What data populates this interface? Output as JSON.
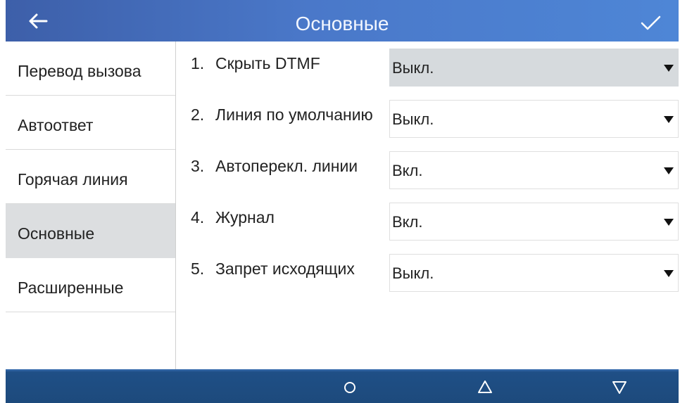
{
  "header": {
    "title": "Основные",
    "back_icon": "back-arrow-icon",
    "confirm_icon": "checkmark-icon"
  },
  "sidebar": {
    "items": [
      {
        "label": "Перевод вызова",
        "active": false
      },
      {
        "label": "Автоответ",
        "active": false
      },
      {
        "label": "Горячая линия",
        "active": false
      },
      {
        "label": "Основные",
        "active": true
      },
      {
        "label": "Расширенные",
        "active": false
      }
    ]
  },
  "settings": [
    {
      "num": "1.",
      "label": "Скрыть DTMF",
      "value": "Выкл.",
      "active": true
    },
    {
      "num": "2.",
      "label": "Линия по умолчанию",
      "value": "Выкл.",
      "active": false
    },
    {
      "num": "3.",
      "label": "Автоперекл. линии",
      "value": "Вкл.",
      "active": false
    },
    {
      "num": "4.",
      "label": "Журнал",
      "value": "Вкл.",
      "active": false
    },
    {
      "num": "5.",
      "label": "Запрет исходящих",
      "value": "Выкл.",
      "active": false
    }
  ],
  "footer": {
    "buttons": [
      "circle-home-icon",
      "triangle-up-icon",
      "triangle-down-icon"
    ]
  },
  "colors": {
    "header": "#4a78c9",
    "footer": "#1d4a7c",
    "active_bg": "#dcdee0"
  }
}
